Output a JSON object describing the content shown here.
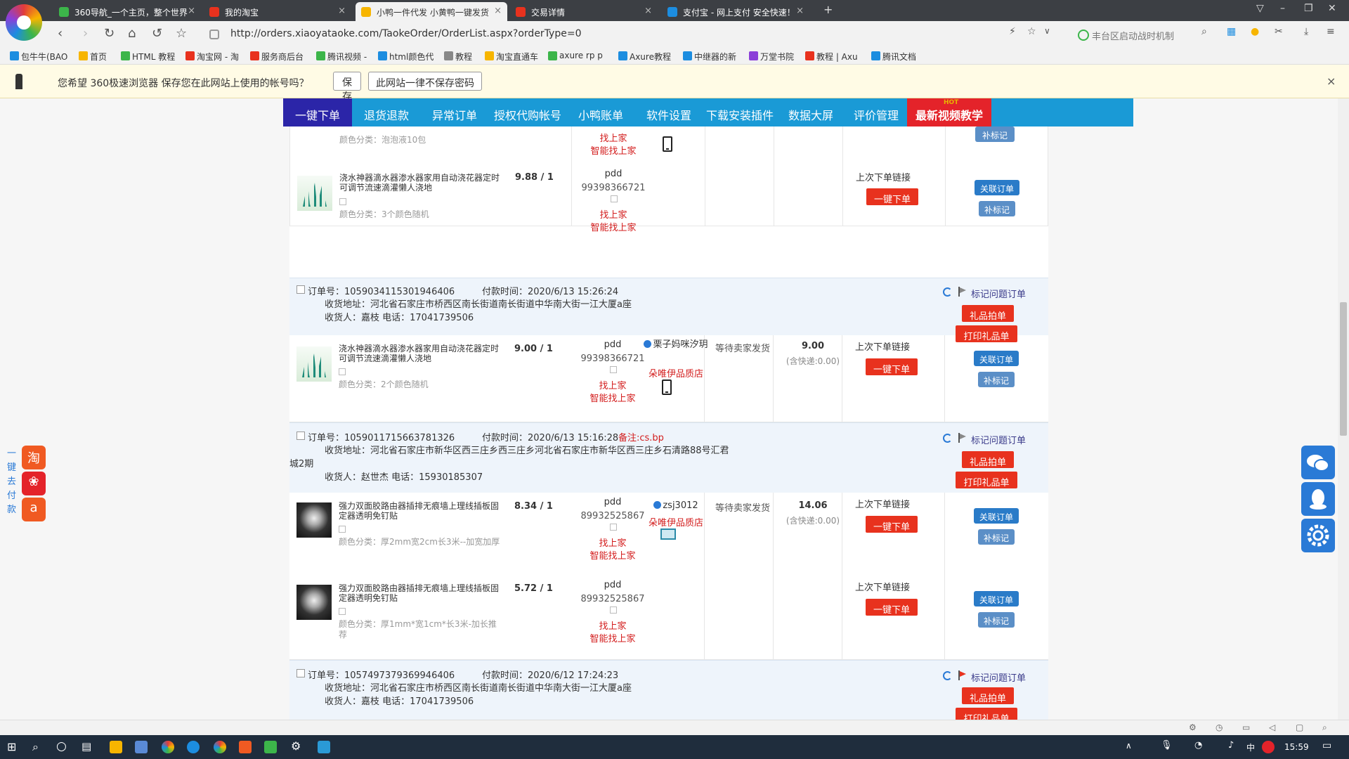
{
  "browser": {
    "tabs": [
      {
        "label": "360导航_一个主页，整个世界",
        "icon_color": "#3cb54a",
        "active": false
      },
      {
        "label": "我的淘宝",
        "icon_color": "#e8321e",
        "active": false
      },
      {
        "label": "小鸭一件代发 小黄鸭一键发货",
        "icon_color": "#f7b500",
        "active": true
      },
      {
        "label": "交易详情",
        "icon_color": "#e8321e",
        "active": false
      },
      {
        "label": "支付宝 - 网上支付 安全快速！",
        "icon_color": "#1c8de0",
        "active": false
      }
    ],
    "new_tab": "+",
    "url": "http://orders.xiaoyataoke.com/TaokeOrder/OrderList.aspx?orderType=0",
    "search_placeholder": "丰台区启动战时机制",
    "bookmarks": [
      {
        "label": "包牛牛(BAO",
        "color": "#1c8de0"
      },
      {
        "label": "首页",
        "color": "#f7b500"
      },
      {
        "label": "HTML 教程",
        "color": "#3cb54a"
      },
      {
        "label": "淘宝网 - 淘",
        "color": "#e8321e"
      },
      {
        "label": "服务商后台",
        "color": "#e8321e"
      },
      {
        "label": "腾讯视频 -",
        "color": "#3cb54a"
      },
      {
        "label": "html颜色代",
        "color": "#1c8de0"
      },
      {
        "label": "教程",
        "color": "#888888"
      },
      {
        "label": "淘宝直通车",
        "color": "#f7b500"
      },
      {
        "label": "axure rp p",
        "color": "#3cb54a"
      },
      {
        "label": "Axure教程",
        "color": "#1c8de0"
      },
      {
        "label": "中继器的新",
        "color": "#1c8de0"
      },
      {
        "label": "万堂书院",
        "color": "#8b3fd8"
      },
      {
        "label": "教程 | Axu",
        "color": "#e8321e"
      },
      {
        "label": "腾讯文档",
        "color": "#1c8de0"
      }
    ]
  },
  "password_bar": {
    "message": "您希望 360极速浏览器 保存您在此网站上使用的帐号吗？",
    "save": "保存",
    "never": "此网站一律不保存密码",
    "close": "×"
  },
  "site_nav": {
    "items": [
      "一键下单",
      "退货退款",
      "异常订单",
      "授权代购帐号",
      "小鸭账单",
      "软件设置",
      "下载安装插件",
      "数据大屏",
      "评价管理",
      "最新视频教学"
    ],
    "hot_badge": "HOT",
    "active_index": 0
  },
  "orders": {
    "top_partial": {
      "category": "颜色分类：泡泡液10包",
      "find_seller": "找上家",
      "smart_find": "智能找上家",
      "mark_btn": "补标记"
    },
    "product_row_1": {
      "name": "浇水神器滴水器渗水器家用自动浇花器定时可调节流速滴灌懒人浇地",
      "category": "颜色分类：3个颜色随机",
      "price": "9.88 / 1",
      "source": "pdd",
      "source_id": "99398366721",
      "find_seller": "找上家",
      "smart_find": "智能找上家",
      "last_link": "上次下单链接",
      "one_click": "一键下单",
      "link_order": "关联订单",
      "mark_btn": "补标记"
    },
    "order_a": {
      "order_no": "订单号：1059034115301946406",
      "pay_time": "付款时间：2020/6/13 15:26:24",
      "address": "收货地址：河北省石家庄市桥西区南长街道南长街道中华南大街一江大厦a座",
      "receiver": "收货人：嘉枝  电话：17041739506",
      "mark_problem": "标记问题订单",
      "gift_order": "礼品拍单",
      "print_gift": "打印礼品单",
      "item": {
        "name": "浇水神器滴水器渗水器家用自动浇花器定时可调节流速滴灌懒人浇地",
        "category": "颜色分类：2个颜色随机",
        "price": "9.00 / 1",
        "source": "pdd",
        "source_id": "99398366721",
        "find_seller": "找上家",
        "smart_find": "智能找上家",
        "buyer": "栗子妈咪汐玥",
        "shop": "朵唯伊品质店",
        "status": "等待卖家发货",
        "amount": "9.00",
        "shipping": "(含快递:0.00)",
        "last_link": "上次下单链接",
        "one_click": "一键下单",
        "link_order": "关联订单",
        "mark_btn": "补标记"
      }
    },
    "order_b": {
      "order_no": "订单号：1059011715663781326",
      "pay_time": "付款时间：2020/6/13 15:16:28",
      "remark": "备注:cs.bp",
      "address": "收货地址：河北省石家庄市新华区西三庄乡西三庄乡河北省石家庄市新华区西三庄乡石清路88号汇君",
      "address_cont": "城2期",
      "receiver": "收货人：赵世杰  电话：15930185307",
      "mark_problem": "标记问题订单",
      "gift_order": "礼品拍单",
      "print_gift": "打印礼品单",
      "items": [
        {
          "name": "强力双面胶路由器插排无痕墙上理线插板固定器透明免钉贴",
          "category": "颜色分类：厚2mm宽2cm长3米--加宽加厚",
          "price": "8.34 / 1",
          "source": "pdd",
          "source_id": "89932525867",
          "find_seller": "找上家",
          "smart_find": "智能找上家",
          "buyer": "zsj3012",
          "shop": "朵唯伊品质店",
          "status": "等待卖家发货",
          "amount": "14.06",
          "shipping": "(含快递:0.00)",
          "last_link": "上次下单链接",
          "one_click": "一键下单",
          "link_order": "关联订单",
          "mark_btn": "补标记"
        },
        {
          "name": "强力双面胶路由器插排无痕墙上理线插板固定器透明免钉贴",
          "category": "颜色分类：厚1mm*宽1cm*长3米-加长推荐",
          "price": "5.72 / 1",
          "source": "pdd",
          "source_id": "89932525867",
          "find_seller": "找上家",
          "smart_find": "智能找上家",
          "last_link": "上次下单链接",
          "one_click": "一键下单",
          "link_order": "关联订单",
          "mark_btn": "补标记"
        }
      ]
    },
    "order_c": {
      "order_no": "订单号：1057497379369946406",
      "pay_time": "付款时间：2020/6/12 17:24:23",
      "address": "收货地址：河北省石家庄市桥西区南长街道南长街道中华南大街一江大厦a座",
      "receiver": "收货人：嘉枝  电话：17041739506",
      "mark_problem": "标记问题订单",
      "gift_order": "礼品拍单",
      "print_gift": "打印礼品单"
    }
  },
  "left_pay": {
    "label_chars": [
      "一",
      "键",
      "去",
      "付",
      "款"
    ],
    "icons": [
      {
        "name": "taobao-icon",
        "glyph": "淘",
        "color": "#f05a22"
      },
      {
        "name": "tmall-icon",
        "glyph": "❀",
        "color": "#e4232a"
      },
      {
        "name": "alibaba-icon",
        "glyph": "a",
        "color": "#f05a22"
      }
    ]
  },
  "taskbar": {
    "time": "15:59",
    "ime": "中"
  }
}
